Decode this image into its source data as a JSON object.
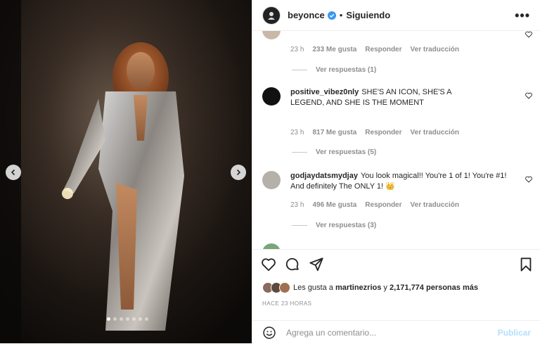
{
  "post": {
    "carousel": {
      "slide_count": 7,
      "active_index": 0
    }
  },
  "header": {
    "username": "beyonce",
    "separator": "•",
    "follow_status": "Siguiendo",
    "more": "•••"
  },
  "comments": [
    {
      "username": "",
      "text": "",
      "time": "23 h",
      "likes": "233 Me gusta",
      "reply": "Responder",
      "translate": "Ver traducción",
      "replies": "Ver respuestas (1)"
    },
    {
      "username": "positive_vibez0nly",
      "text": "SHE'S AN ICON, SHE'S A LEGEND, AND SHE IS THE MOMENT",
      "time": "23 h",
      "likes": "817 Me gusta",
      "reply": "Responder",
      "translate": "Ver traducción",
      "replies": "Ver respuestas (5)"
    },
    {
      "username": "godjaydatsmydjay",
      "text": "You look magical!! You're 1 of 1! You're #1! And definitely The ONLY 1! 👑",
      "time": "23 h",
      "likes": "496 Me gusta",
      "reply": "Responder",
      "translate": "Ver traducción",
      "replies": "Ver respuestas (3)"
    }
  ],
  "likes": {
    "prefix": "Les gusta a",
    "user": "martinezrios",
    "connector": "y",
    "others": "2,171,774 personas más"
  },
  "timestamp": "HACE 23 HORAS",
  "comment_box": {
    "placeholder": "Agrega un comentario...",
    "publish": "Publicar"
  },
  "colors": {
    "verified": "#3897f0",
    "publish_disabled": "#b2dffc",
    "muted_text": "#8e8e8e"
  },
  "icons": [
    "chevron-left-icon",
    "chevron-right-icon",
    "heart-icon",
    "comment-icon",
    "share-icon",
    "bookmark-icon",
    "emoji-icon",
    "more-icon",
    "verified-icon"
  ]
}
